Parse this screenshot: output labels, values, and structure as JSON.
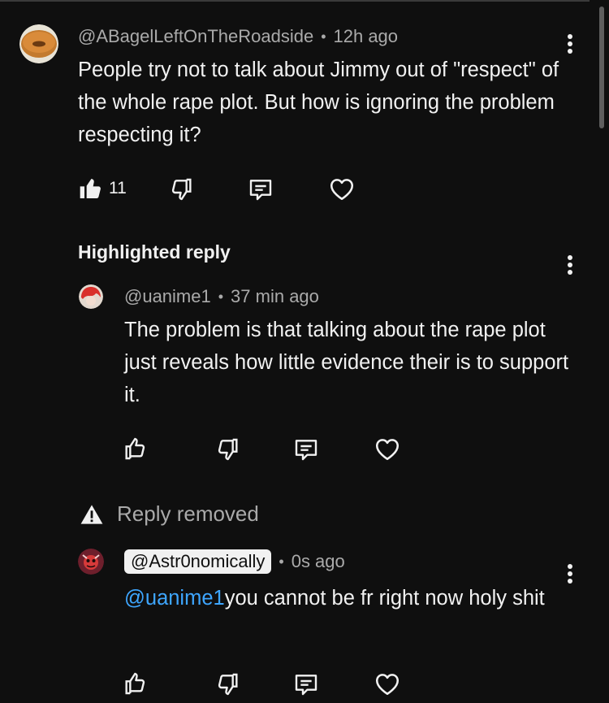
{
  "comment": {
    "author": "@ABagelLeftOnTheRoadside",
    "time": "12h ago",
    "text": "People try not to talk about Jimmy out of \"respect\" of the whole rape plot. But how is ignoring the problem respecting it?",
    "likes": "11"
  },
  "highlight_label": "Highlighted reply",
  "reply1": {
    "author": "@uanime1",
    "time": "37 min ago",
    "text": "The problem is that talking about the rape plot just reveals how little evidence their is to support it."
  },
  "removed_label": "Reply removed",
  "reply2": {
    "author": "@Astr0nomically",
    "time": "0s ago",
    "mention": "@uanime1",
    "text": "you cannot be fr right now holy shit"
  },
  "colors": {
    "background": "#0f0f0f",
    "text": "#f1f1f1",
    "meta": "#aaaaaa",
    "link": "#3ea6ff"
  },
  "icons": [
    "thumb-up-icon",
    "thumb-down-icon",
    "reply-icon",
    "heart-icon",
    "more-vert-icon",
    "warning-icon"
  ]
}
